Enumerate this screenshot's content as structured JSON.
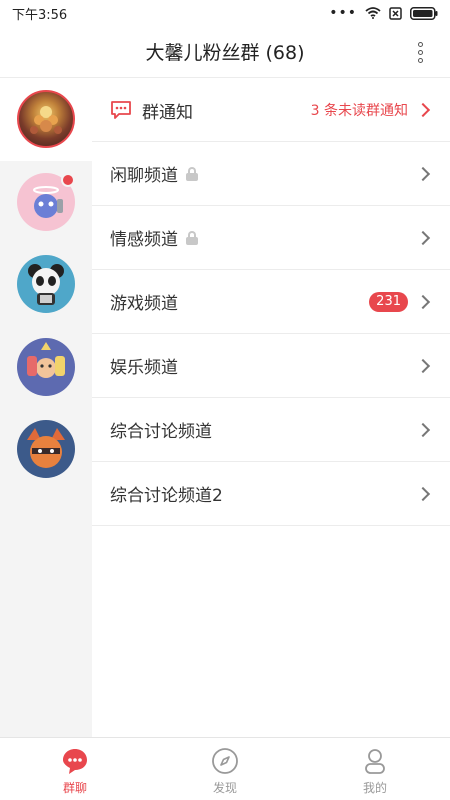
{
  "status_bar": {
    "time": "下午3:56"
  },
  "header": {
    "title": "大馨儿粉丝群 (68)"
  },
  "notice": {
    "label": "群通知",
    "status": "3 条未读群通知"
  },
  "channels": [
    {
      "label": "闲聊频道",
      "locked": true
    },
    {
      "label": "情感频道",
      "locked": true
    },
    {
      "label": "游戏频道",
      "badge": "231"
    },
    {
      "label": "娱乐频道"
    },
    {
      "label": "综合讨论频道"
    },
    {
      "label": "综合讨论频道2"
    }
  ],
  "tabs": [
    {
      "label": "群聊",
      "icon": "chat-bubble-icon",
      "active": true
    },
    {
      "label": "发现",
      "icon": "compass-icon"
    },
    {
      "label": "我的",
      "icon": "person-icon"
    }
  ],
  "colors": {
    "accent": "#e8474d"
  }
}
